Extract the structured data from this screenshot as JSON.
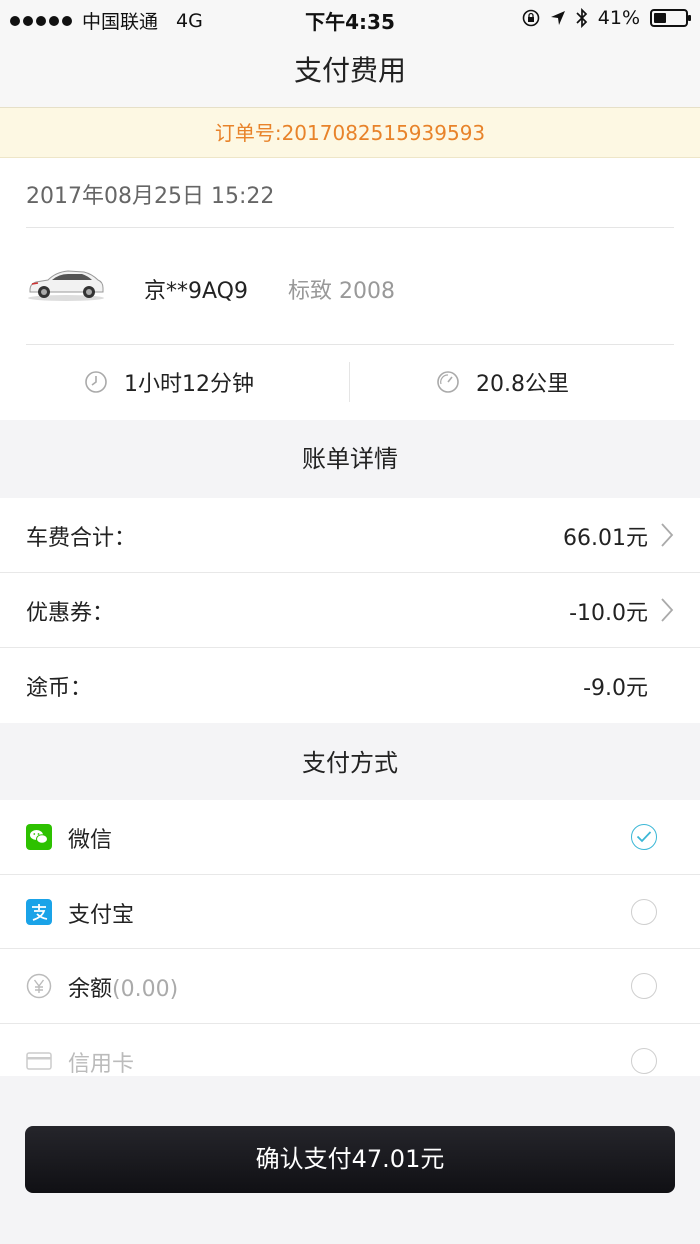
{
  "status_bar": {
    "carrier": "中国联通",
    "network": "4G",
    "time": "下午4:35",
    "battery_percent": "41%",
    "battery_level": 0.41
  },
  "nav": {
    "title": "支付费用"
  },
  "order": {
    "label": "订单号:2017082515939593"
  },
  "trip": {
    "datetime": "2017年08月25日 15:22",
    "plate": "京**9AQ9",
    "model": "标致 2008",
    "duration": "1小时12分钟",
    "distance": "20.8公里"
  },
  "bill": {
    "title": "账单详情",
    "rows": [
      {
        "label": "车费合计：",
        "value": "66.01元"
      },
      {
        "label": "优惠券：",
        "value": "-10.0元"
      },
      {
        "label": "途币：",
        "value": "-9.0元"
      }
    ]
  },
  "payment": {
    "title": "支付方式",
    "methods": [
      {
        "label": "微信",
        "extra": "",
        "selected": true
      },
      {
        "label": "支付宝",
        "extra": "",
        "selected": false
      },
      {
        "label": "余额",
        "extra": "(0.00)",
        "selected": false
      },
      {
        "label": "信用卡",
        "extra": "",
        "selected": false
      }
    ]
  },
  "confirm": {
    "label": "确认支付47.01元"
  },
  "colors": {
    "order_accent": "#e8832a",
    "check_accent": "#3bb7d6",
    "wechat_green": "#2dc100",
    "alipay_blue": "#1aa3e8"
  }
}
